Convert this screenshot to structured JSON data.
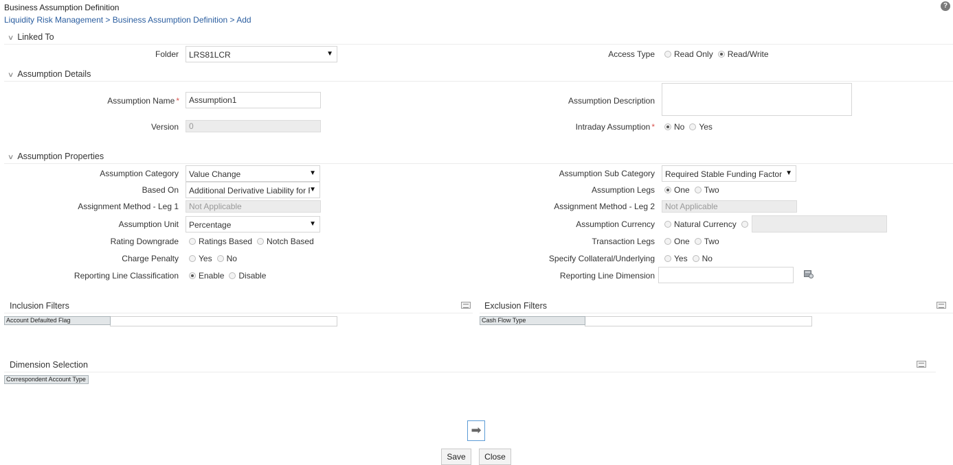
{
  "header": {
    "title": "Business Assumption Definition",
    "help_icon_glyph": "?",
    "breadcrumb": [
      "Liquidity Risk Management",
      "Business Assumption Definition",
      "Add"
    ],
    "breadcrumb_sep": ">"
  },
  "sections": {
    "linked_to": "Linked To",
    "assumption_details": "Assumption Details",
    "assumption_properties": "Assumption Properties"
  },
  "linked_to": {
    "folder_label": "Folder",
    "folder_value": "LRS81LCR",
    "access_type_label": "Access Type",
    "access_options": [
      "Read Only",
      "Read/Write"
    ],
    "access_selected": "Read/Write"
  },
  "details": {
    "name_label": "Assumption Name",
    "required_mark": "*",
    "name_value": "Assumption1",
    "version_label": "Version",
    "version_value": "0",
    "description_label": "Assumption Description",
    "description_value": "",
    "intraday_label": "Intraday Assumption",
    "intraday_options": [
      "No",
      "Yes"
    ],
    "intraday_selected": "No"
  },
  "properties": {
    "category_label": "Assumption Category",
    "category_value": "Value Change",
    "sub_category_label": "Assumption Sub Category",
    "sub_category_value": "Required Stable Funding Factor",
    "based_on_label": "Based On",
    "based_on_value": "Additional Derivative Liability for R",
    "legs_label": "Assumption Legs",
    "legs_options": [
      "One",
      "Two"
    ],
    "legs_selected": "One",
    "method_leg1_label": "Assignment Method - Leg 1",
    "method_leg1_value": "Not Applicable",
    "method_leg2_label": "Assignment Method - Leg 2",
    "method_leg2_value": "Not Applicable",
    "unit_label": "Assumption Unit",
    "unit_value": "Percentage",
    "currency_label": "Assumption Currency",
    "currency_options": [
      "Natural Currency"
    ],
    "currency_value": "",
    "rating_label": "Rating Downgrade",
    "rating_options": [
      "Ratings Based",
      "Notch Based"
    ],
    "transaction_legs_label": "Transaction Legs",
    "transaction_legs_options": [
      "One",
      "Two"
    ],
    "charge_penalty_label": "Charge Penalty",
    "charge_penalty_options": [
      "Yes",
      "No"
    ],
    "collateral_label": "Specify Collateral/Underlying",
    "collateral_options": [
      "Yes",
      "No"
    ],
    "reporting_class_label": "Reporting Line Classification",
    "reporting_class_options": [
      "Enable",
      "Disable"
    ],
    "reporting_class_selected": "Enable",
    "reporting_dim_label": "Reporting Line Dimension",
    "reporting_dim_value": ""
  },
  "filters": {
    "inclusion_title": "Inclusion Filters",
    "inclusion_tag": "Account Defaulted Flag",
    "exclusion_title": "Exclusion Filters",
    "exclusion_tag": "Cash Flow Type",
    "dimension_title": "Dimension Selection",
    "dimension_tag": "Correspondent Account Type"
  },
  "footer": {
    "arrow_glyph": "➡",
    "save_label": "Save",
    "close_label": "Close"
  },
  "colors": {
    "breadcrumb": "#2a5d9f",
    "required": "#d9534f",
    "arrow_border": "#5b9bd5"
  }
}
